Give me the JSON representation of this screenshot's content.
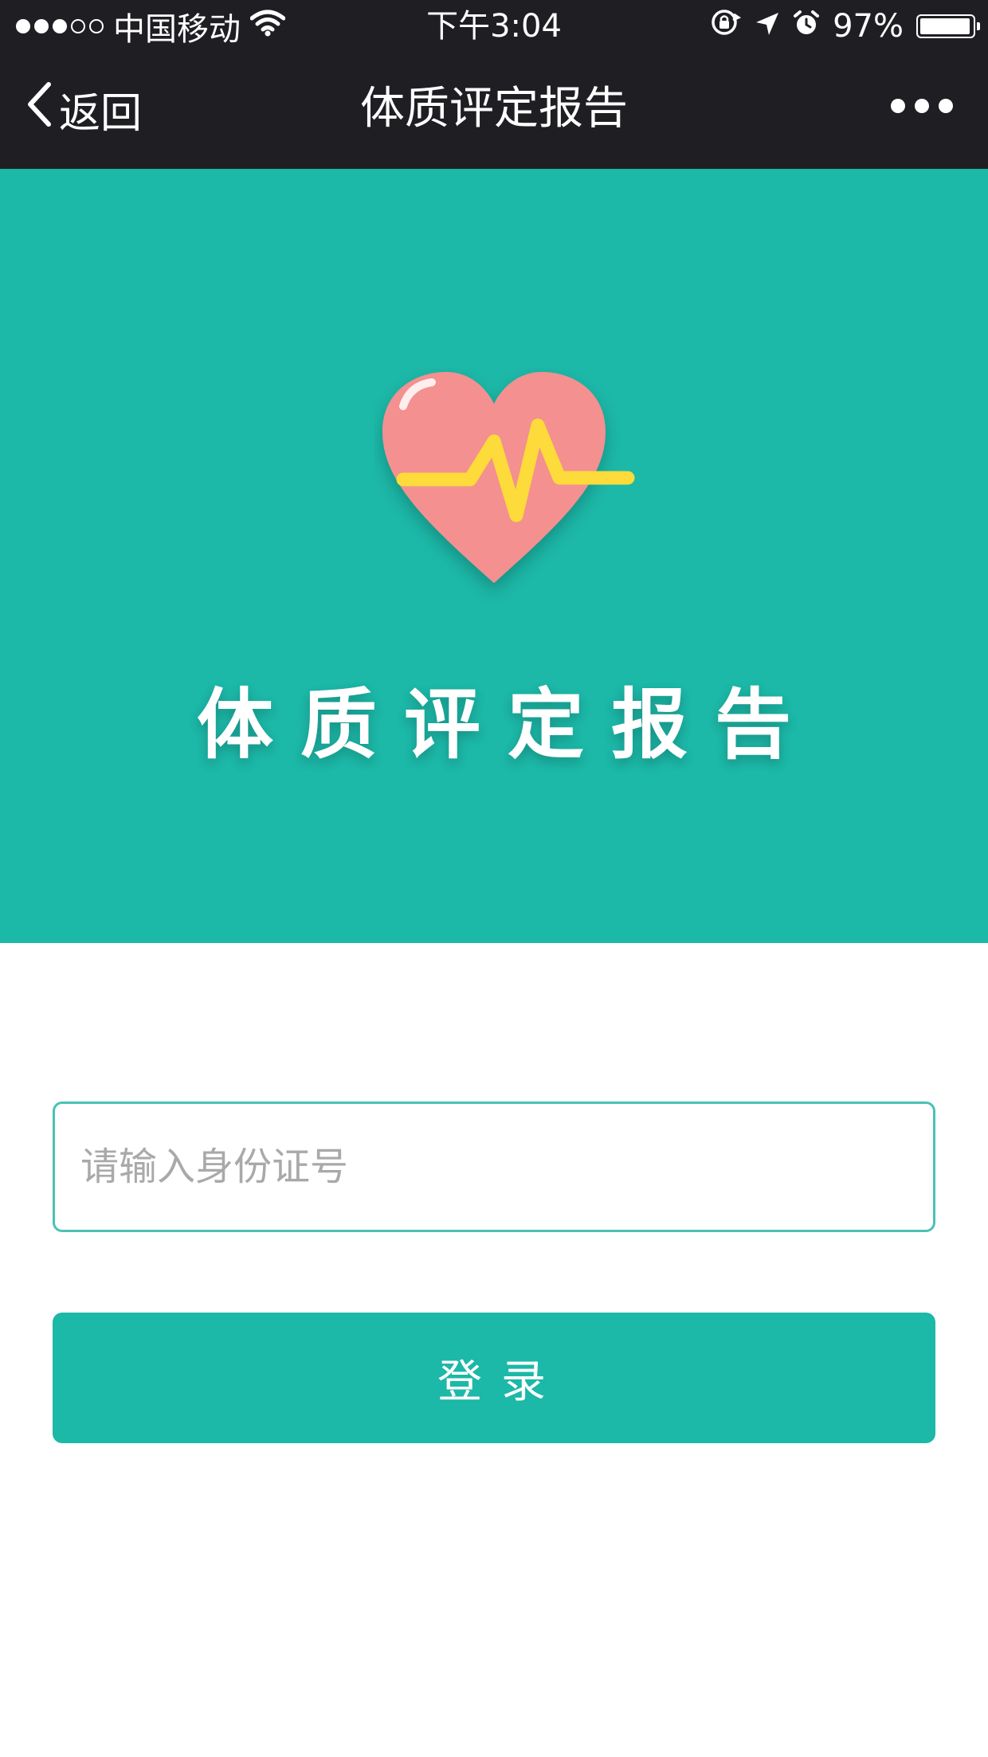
{
  "status_bar": {
    "signal": {
      "filled": 3,
      "total": 5
    },
    "carrier": "中国移动",
    "time": "下午3:04",
    "battery_percent": "97%",
    "battery_level": 0.97,
    "icons": [
      "signal-dots-icon",
      "wifi-icon",
      "orientation-lock-icon",
      "location-arrow-icon",
      "alarm-icon",
      "battery-icon"
    ]
  },
  "nav": {
    "back_label": "返回",
    "title": "体质评定报告",
    "more_icon": "more-dots-icon"
  },
  "hero": {
    "title": "体质评定报告",
    "icon": "heart-pulse-icon",
    "colors": {
      "background": "#1cb8a8",
      "heart": "#f4908f",
      "pulse": "#fddb3a"
    }
  },
  "form": {
    "id_input": {
      "value": "",
      "placeholder": "请输入身份证号"
    },
    "login_label": "登录"
  },
  "colors": {
    "nav_background": "#1f1e23",
    "accent": "#1cb8a8",
    "input_border": "#48c2b6"
  }
}
